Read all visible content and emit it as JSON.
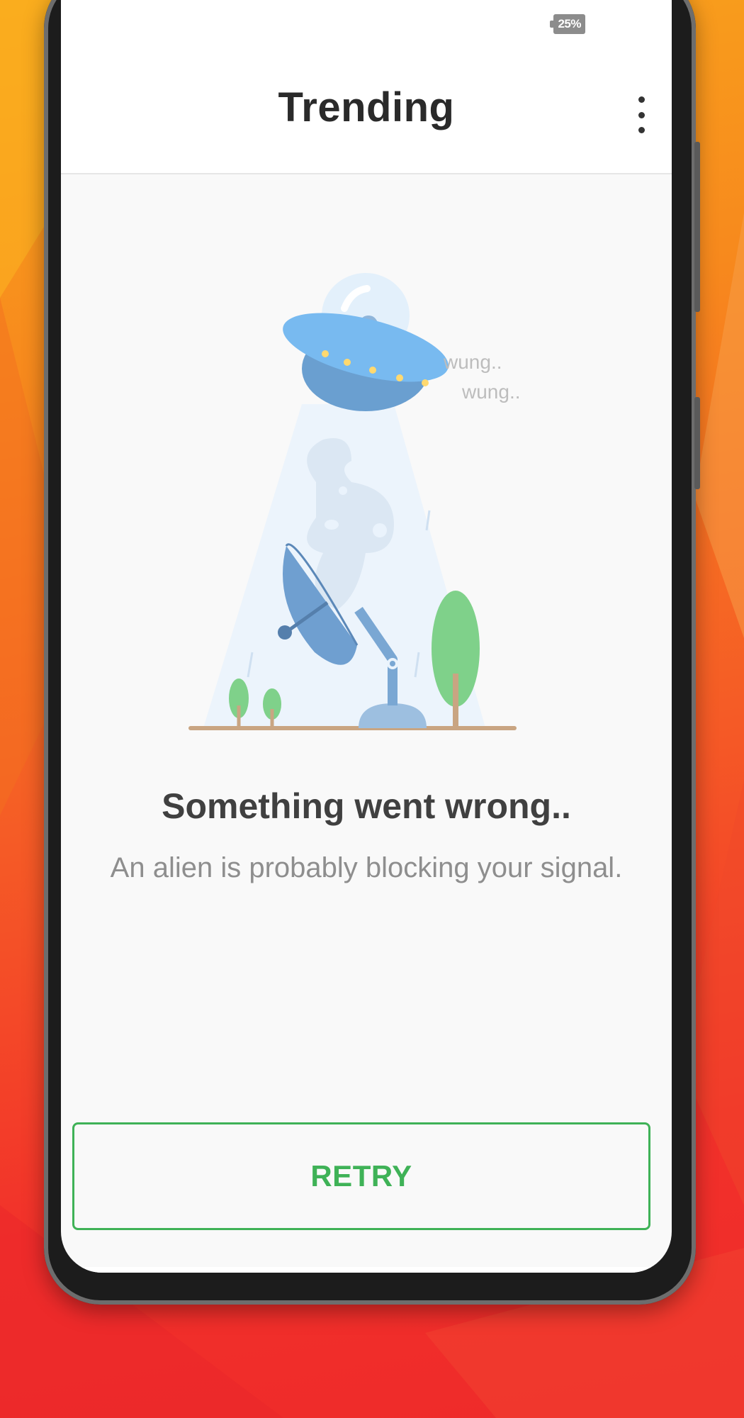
{
  "status_bar": {
    "battery": "25%"
  },
  "app_bar": {
    "title": "Trending",
    "menu_icon": "more-vert-icon"
  },
  "illustration": {
    "sound_1": "wung..",
    "sound_2": "wung.."
  },
  "error": {
    "title": "Something went wrong..",
    "message": "An alien is probably blocking your signal."
  },
  "actions": {
    "retry_label": "RETRY"
  },
  "colors": {
    "accent_green": "#3fb257",
    "ufo_blue": "#72b4ee",
    "tree_green": "#7fd18a",
    "background_orange": "#f7891d",
    "background_red": "#f2312a"
  }
}
